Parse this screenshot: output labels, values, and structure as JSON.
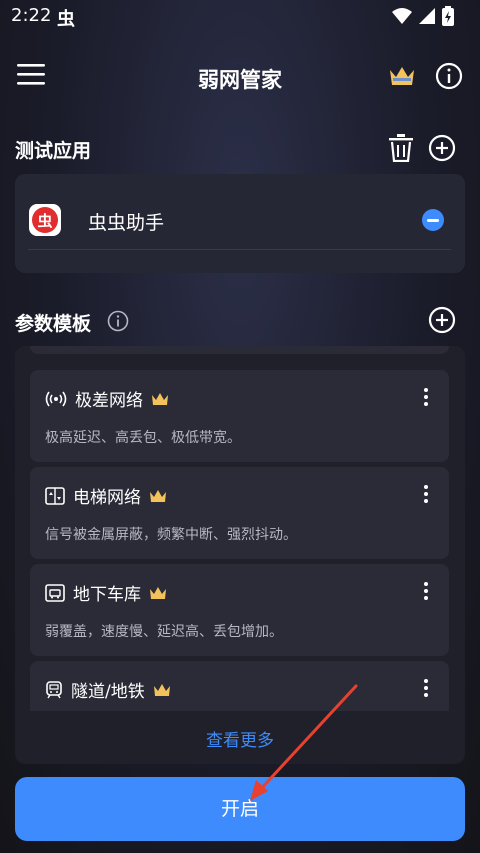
{
  "status_bar": {
    "time": "2:22",
    "app_glyph": "虫"
  },
  "toolbar": {
    "title": "弱网管家"
  },
  "test_apps": {
    "title": "测试应用",
    "items": [
      {
        "name": "虫虫助手",
        "icon": "app-logo-icon"
      }
    ]
  },
  "templates": {
    "title": "参数模板",
    "items": [
      {
        "name": "极差网络",
        "desc": "极高延迟、高丢包、极低带宽。",
        "icon": "signal-icon"
      },
      {
        "name": "电梯网络",
        "desc": "信号被金属屏蔽，频繁中断、强烈抖动。",
        "icon": "elevator-icon"
      },
      {
        "name": "地下车库",
        "desc": "弱覆盖，速度慢、延迟高、丢包增加。",
        "icon": "garage-icon"
      },
      {
        "name": "隧道/地铁",
        "desc": "",
        "icon": "subway-icon"
      }
    ],
    "view_more": "查看更多"
  },
  "start_button": {
    "label": "开启"
  },
  "colors": {
    "accent": "#3d8bfd",
    "crown": "#f4c25a",
    "card": "#2a2b37"
  }
}
